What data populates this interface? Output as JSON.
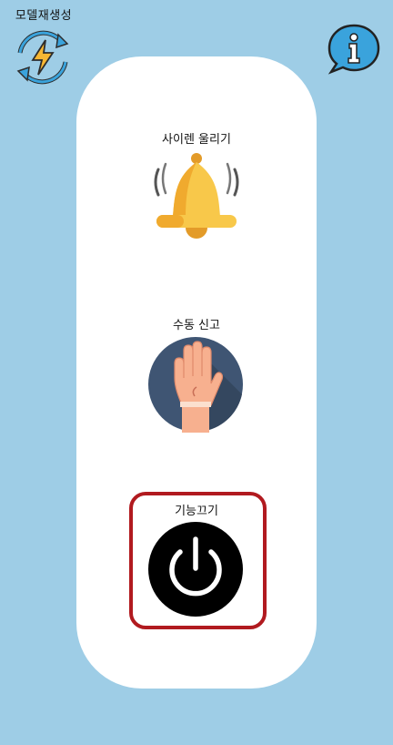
{
  "header": {
    "regen_label": "모델재생성"
  },
  "menu": {
    "items": [
      {
        "label": "사이렌 울리기",
        "icon": "bell-icon"
      },
      {
        "label": "수동 신고",
        "icon": "raised-hand-icon"
      },
      {
        "label": "기능끄기",
        "icon": "power-icon"
      }
    ]
  },
  "colors": {
    "background": "#9ecde6",
    "panel": "#ffffff",
    "highlight_border": "#b11a1f",
    "bell_yellow": "#f8c84a",
    "hand_circle": "#3f5573",
    "power_black": "#000000"
  }
}
